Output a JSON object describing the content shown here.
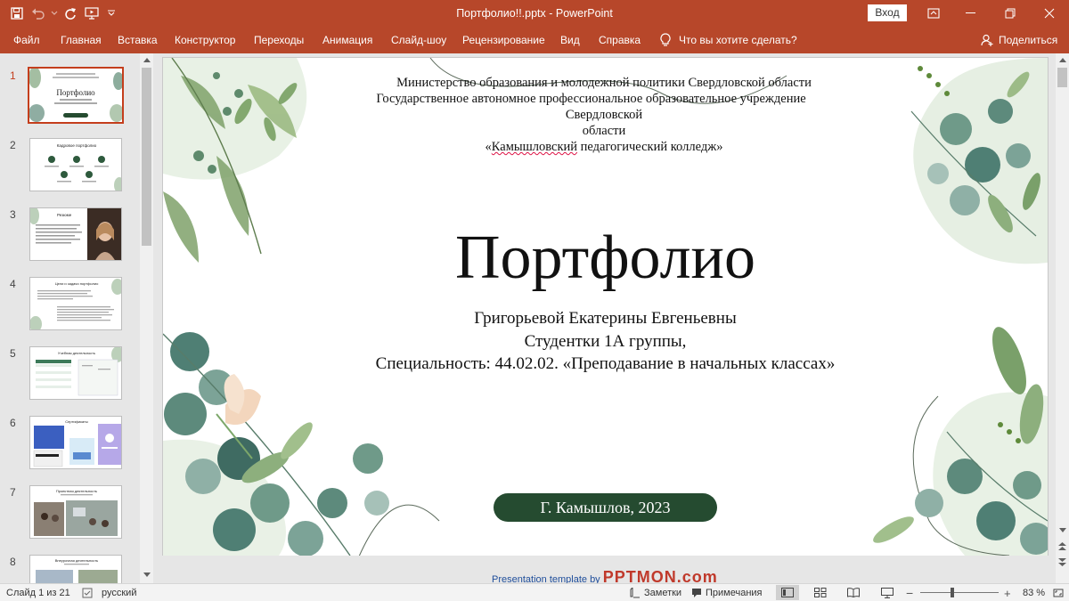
{
  "window": {
    "doc_title": "Портфолио!!.pptx  -  PowerPoint",
    "sign_in_label": "Вход"
  },
  "ribbon": {
    "tabs": [
      "Файл",
      "Главная",
      "Вставка",
      "Конструктор",
      "Переходы",
      "Анимация",
      "Слайд-шоу",
      "Рецензирование",
      "Вид",
      "Справка"
    ],
    "tell_me": "Что вы хотите сделать?",
    "share": "Поделиться"
  },
  "thumbnails": {
    "numbers": [
      "1",
      "2",
      "3",
      "4",
      "5",
      "6",
      "7",
      "8"
    ],
    "active": "1",
    "mini_titles": [
      "Портфолио",
      "Кадровое портфолио",
      "Резюме",
      "Цели и задачи портфолио",
      "Учебная деятельность",
      "Сертификаты",
      "Проектная деятельность",
      "Внеурочная деятельность"
    ]
  },
  "slide": {
    "institution_line1": "Министерство образования и молодежной политики Свердловской области",
    "institution_line2_a": "Государственное автономное профессиональное образовательное учреждение",
    "institution_line2_b": "Свердловской",
    "institution_line2_c": "области",
    "institution_line3_a": "«",
    "institution_line3_b": "Камышловский",
    "institution_line3_c": " педагогический колледж»",
    "title": "Портфолио",
    "name": "Григорьевой Екатерины Евгеньевны",
    "group": "Студентки 1А группы,",
    "specialty": "Специальность: 44.02.02. «Преподавание в начальных классах»",
    "city_year": "Г. Камышлов, 2023"
  },
  "template_credit": {
    "text": "Presentation template by",
    "brand": "PPTMON.com"
  },
  "statusbar": {
    "slide_counter": "Слайд 1 из 21",
    "language": "русский",
    "notes": "Заметки",
    "comments": "Примечания",
    "zoom": "83 %",
    "zoom_fraction": 0.83
  },
  "colors": {
    "accent": "#b7472a",
    "slide_pill": "#254b30",
    "thumb_active": "#c43e1c",
    "leaf_dark": "#3f6b62",
    "leaf_light": "#8fb08c"
  },
  "icons": [
    "save-icon",
    "undo-icon",
    "redo-icon",
    "present-icon",
    "customize-icon",
    "ribbon-display-icon",
    "minimize-icon",
    "restore-icon",
    "close-icon",
    "lightbulb-icon",
    "share-person-icon",
    "notes-icon",
    "comments-icon",
    "normal-view-icon",
    "slide-sorter-icon",
    "reading-view-icon",
    "slideshow-icon"
  ]
}
